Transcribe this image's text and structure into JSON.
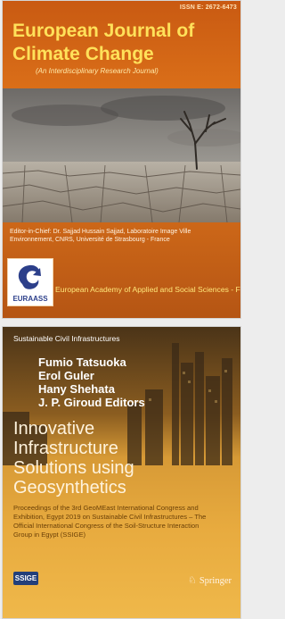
{
  "cover1": {
    "issn": "ISSN E: 2672-6473",
    "title": "European Journal of Climate Change",
    "subtitle": "(An Interdisciplinary Research Journal)",
    "editor": "Editor-in-Chief: Dr. Sajjad Hussain Sajjad, Laboratoire Image Ville Environnement, CNRS, Université de Strasbourg - France",
    "logo_text": "EURAASS",
    "academy": "European Academy of Applied and Social Sciences - France"
  },
  "cover2": {
    "series": "Sustainable Civil Infrastructures",
    "authors": [
      "Fumio Tatsuoka",
      "Erol Guler",
      "Hany Shehata",
      "J. P. Giroud  Editors"
    ],
    "title_lines": [
      "Innovative",
      "Infrastructure",
      "Solutions using",
      "Geosynthetics"
    ],
    "proceedings": "Proceedings of the 3rd GeoMEast International Congress and Exhibition, Egypt 2019 on Sustainable Civil Infrastructures – The Official International Congress of the Soil-Structure Interaction Group in Egypt (SSIGE)",
    "logo": "SSIGE",
    "publisher": "Springer"
  }
}
